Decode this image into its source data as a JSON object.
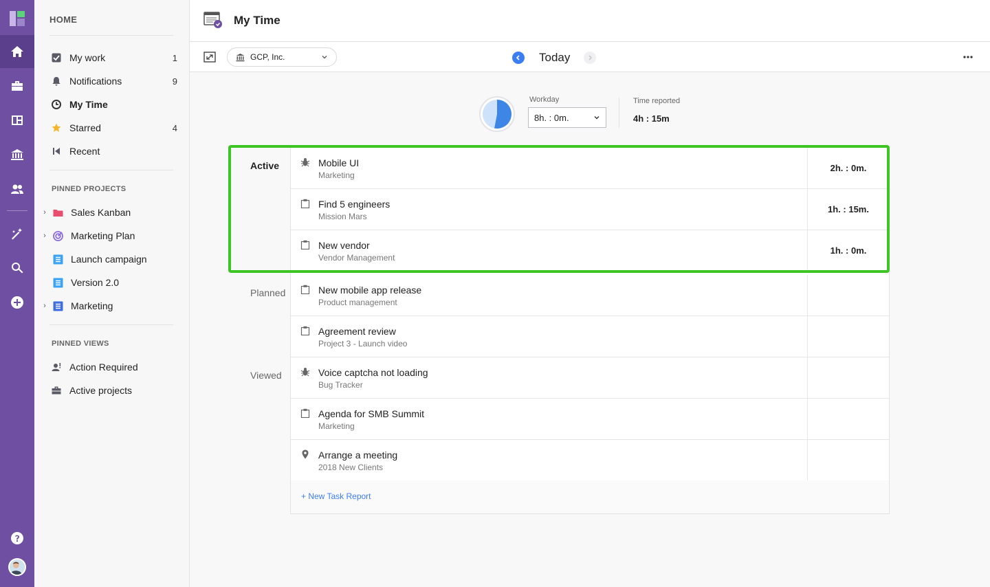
{
  "app": {
    "colors": {
      "rail": "#6e4fa2",
      "accent": "#3d7df4",
      "highlight": "#3dc425"
    }
  },
  "rail": {
    "items": [
      "home-icon",
      "briefcase-icon",
      "dashboard-icon",
      "bank-icon",
      "people-icon",
      "magic-wand-icon",
      "search-icon",
      "plus-circle-icon",
      "help-icon"
    ]
  },
  "sidebar": {
    "home": "HOME",
    "items": [
      {
        "label": "My work",
        "count": "1",
        "icon": "checkbox-icon"
      },
      {
        "label": "Notifications",
        "count": "9",
        "icon": "bell-icon"
      },
      {
        "label": "My Time",
        "count": "",
        "icon": "clock-icon"
      },
      {
        "label": "Starred",
        "count": "4",
        "icon": "star-icon"
      },
      {
        "label": "Recent",
        "count": "",
        "icon": "recent-icon"
      }
    ],
    "pinned_projects_title": "PINNED PROJECTS",
    "pinned_projects": [
      {
        "label": "Sales Kanban",
        "icon": "folder-icon",
        "expandable": true
      },
      {
        "label": "Marketing Plan",
        "icon": "target-icon",
        "expandable": true
      },
      {
        "label": "Launch campaign",
        "icon": "list-icon",
        "expandable": false
      },
      {
        "label": "Version 2.0",
        "icon": "list-icon",
        "expandable": false
      },
      {
        "label": "Marketing",
        "icon": "list-icon",
        "expandable": true
      }
    ],
    "pinned_views_title": "PINNED VIEWS",
    "pinned_views": [
      {
        "label": "Action Required",
        "icon": "user-alert-icon"
      },
      {
        "label": "Active projects",
        "icon": "briefcase-icon"
      }
    ]
  },
  "header": {
    "title": "My Time"
  },
  "toolbar": {
    "company": "GCP, Inc.",
    "date_label": "Today"
  },
  "summary": {
    "workday_label": "Workday",
    "workday_value": "8h. : 0m.",
    "reported_label": "Time reported",
    "reported_value": "4h : 15m",
    "reported_fraction": 0.53
  },
  "groups": {
    "active": "Active",
    "planned": "Planned",
    "viewed": "Viewed"
  },
  "tasks": [
    {
      "name": "Mobile UI",
      "project": "Marketing",
      "time": "2h. : 0m.",
      "icon": "bug-icon"
    },
    {
      "name": "Find 5 engineers",
      "project": "Mission Mars",
      "time": "1h. : 15m.",
      "icon": "clipboard-icon"
    },
    {
      "name": "New vendor",
      "project": "Vendor Management",
      "time": "1h. : 0m.",
      "icon": "clipboard-icon"
    },
    {
      "name": "New mobile app release",
      "project": "Product management",
      "time": "",
      "icon": "clipboard-icon"
    },
    {
      "name": "Agreement review",
      "project": "Project 3 - Launch video",
      "time": "",
      "icon": "clipboard-icon"
    },
    {
      "name": "Voice captcha not loading",
      "project": "Bug Tracker",
      "time": "",
      "icon": "bug-icon"
    },
    {
      "name": "Agenda for SMB Summit",
      "project": "Marketing",
      "time": "",
      "icon": "clipboard-icon"
    },
    {
      "name": "Arrange a meeting",
      "project": "2018 New Clients",
      "time": "",
      "icon": "pin-icon"
    }
  ],
  "new_task_label": "+ New Task Report"
}
